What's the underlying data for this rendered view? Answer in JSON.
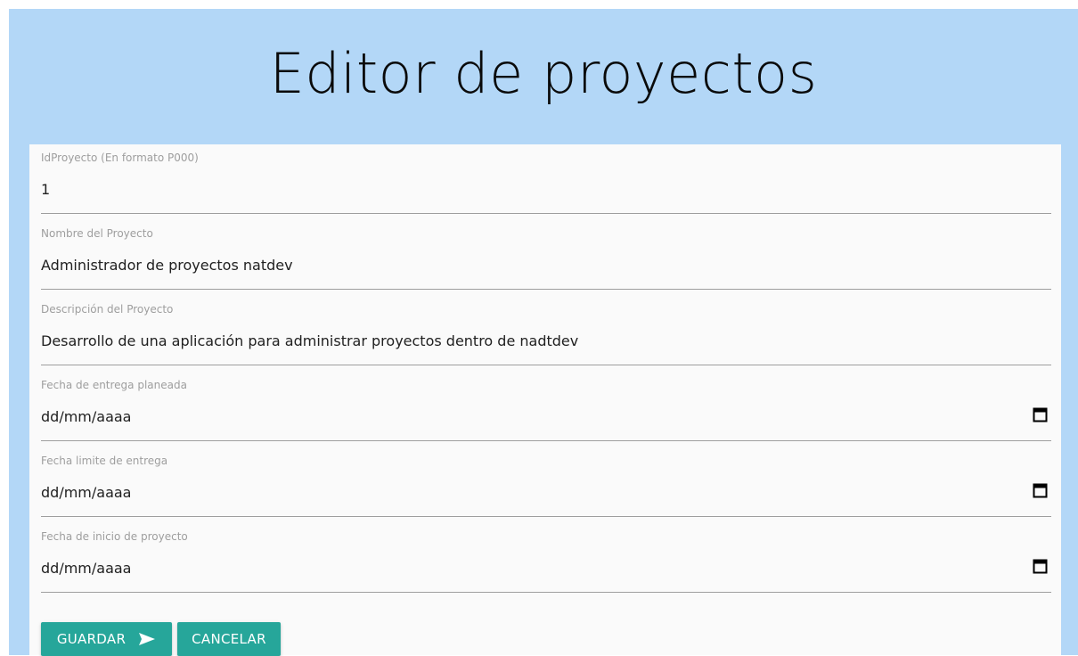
{
  "header": {
    "title": "Editor de proyectos"
  },
  "form": {
    "fields": [
      {
        "label": "IdProyecto (En formato P000)",
        "value": "1"
      },
      {
        "label": "Nombre del Proyecto",
        "value": "Administrador de proyectos natdev"
      },
      {
        "label": "Descripción del Proyecto",
        "value": "Desarrollo de una aplicación para administrar proyectos dentro de nadtdev"
      },
      {
        "label": "Fecha de entrega planeada",
        "value": "dd/mm/aaaa"
      },
      {
        "label": "Fecha limite de entrega",
        "value": "dd/mm/aaaa"
      },
      {
        "label": "Fecha de inicio de proyecto",
        "value": "dd/mm/aaaa"
      }
    ]
  },
  "actions": {
    "save_label": "GUARDAR",
    "cancel_label": "CANCELAR"
  },
  "icons": {
    "save": "send-icon",
    "date": "calendar-icon"
  },
  "colors": {
    "header_bg": "#b3d7f7",
    "card_bg": "#fafafa",
    "button": "#26a69a"
  }
}
